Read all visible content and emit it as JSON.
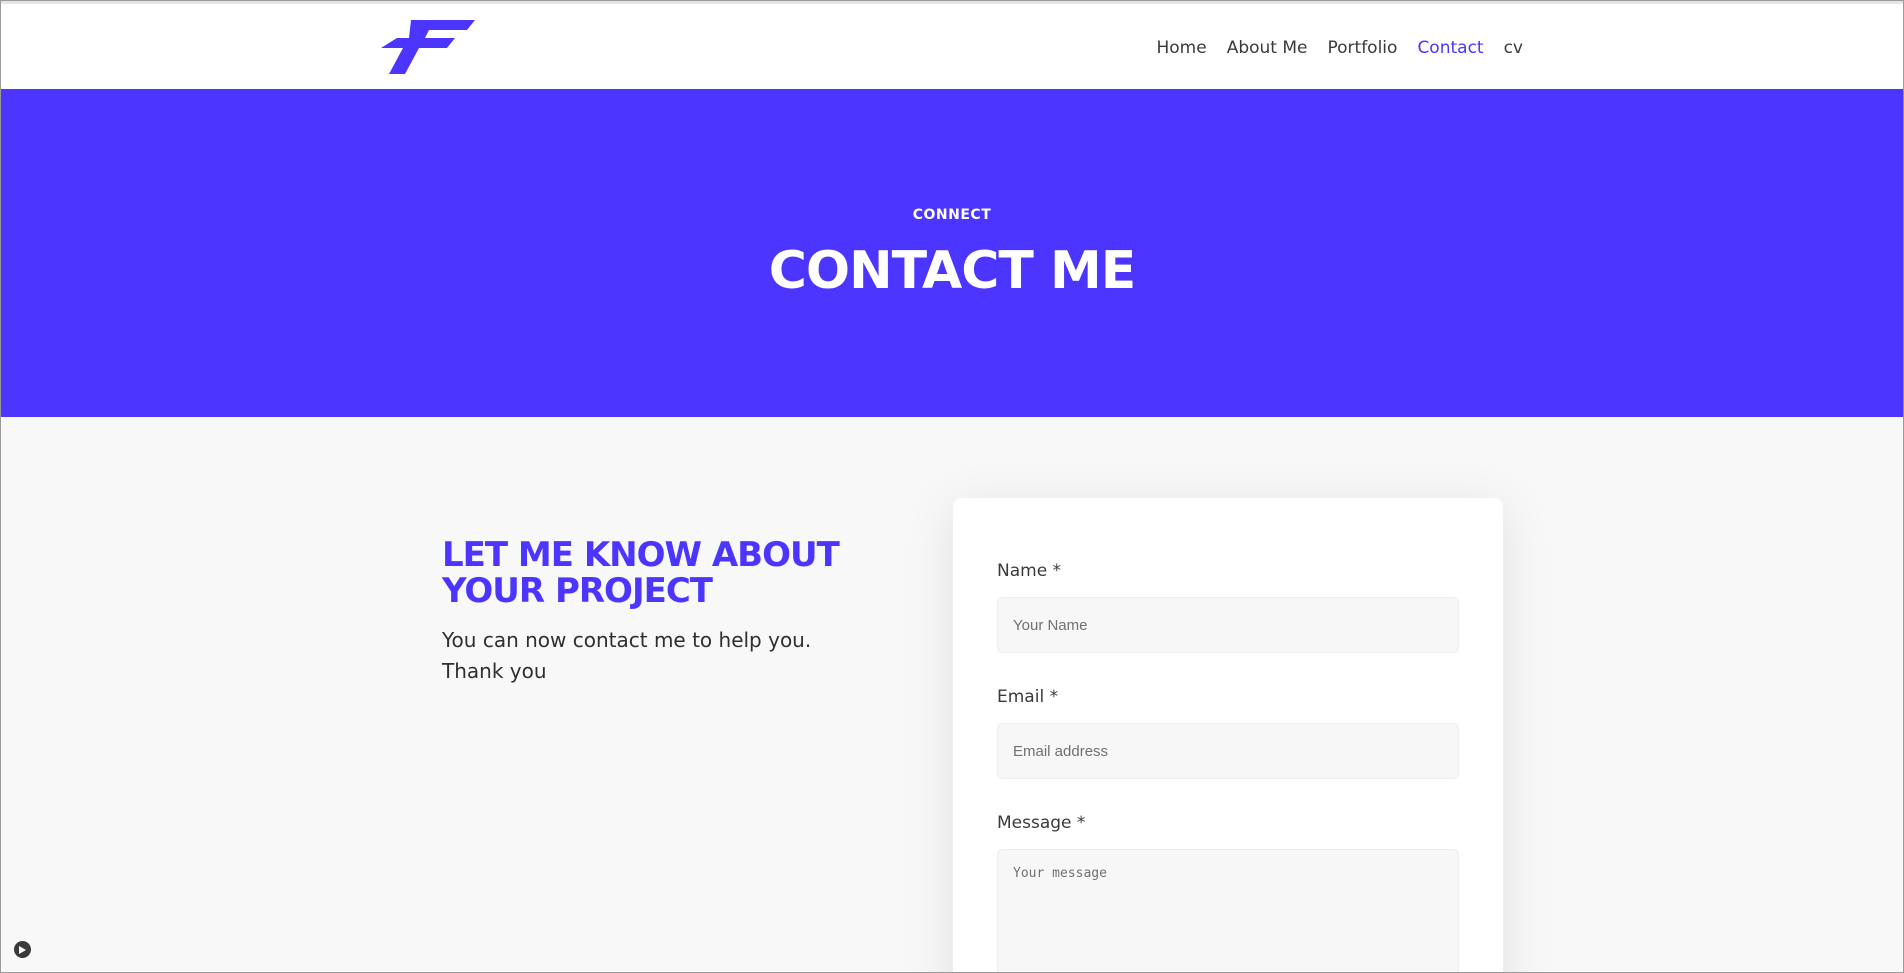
{
  "nav": {
    "items": [
      {
        "label": "Home"
      },
      {
        "label": "About Me"
      },
      {
        "label": "Portfolio"
      },
      {
        "label": "Contact",
        "active": true
      },
      {
        "label": "cv"
      }
    ]
  },
  "hero": {
    "kicker": "CONNECT",
    "title": "CONTACT ME"
  },
  "intro": {
    "heading": "LET ME KNOW ABOUT YOUR PROJECT",
    "line1": "You can now contact me to help you.",
    "line2": "Thank you"
  },
  "form": {
    "name_label": "Name *",
    "name_placeholder": "Your Name",
    "email_label": "Email *",
    "email_placeholder": "Email address",
    "message_label": "Message *",
    "message_placeholder": "Your message"
  },
  "colors": {
    "accent": "#4b35ff",
    "background": "#f8f8f8",
    "text": "#3a3a3a"
  },
  "icons": {
    "logo": "f-logo",
    "play": "play-icon"
  }
}
